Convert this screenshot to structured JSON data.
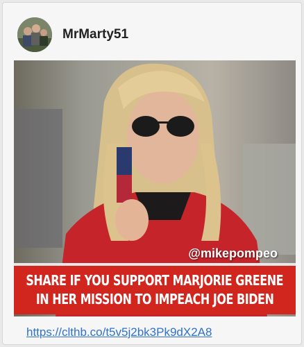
{
  "post": {
    "username": "MrMarty51",
    "avatar_icon": "profile-photo-group",
    "image": {
      "watermark": "@mikepompeo",
      "banner_lines": [
        "SHARE IF YOU SUPPORT MARJORIE GREENE",
        "IN HER MISSION TO IMPEACH JOE BIDEN"
      ],
      "banner_color": "#d1261d"
    },
    "link_text": "https://clthb.co/t5v5j2bk3Pk9dX2A8"
  }
}
